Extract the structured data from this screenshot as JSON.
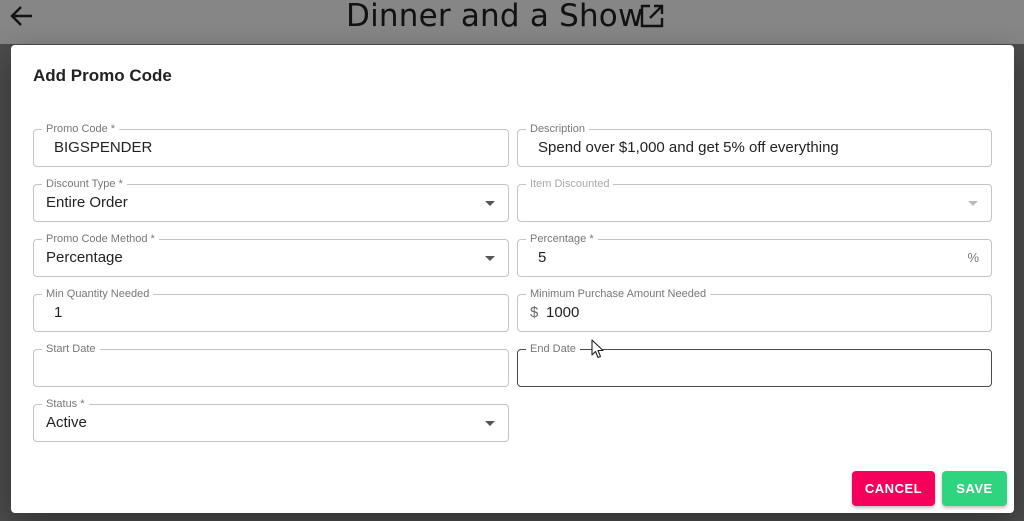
{
  "page": {
    "title": "Dinner and a Show",
    "back_icon": "arrow-left-icon",
    "edit_icon": "open-in-new-icon"
  },
  "dialog": {
    "title": "Add Promo Code",
    "fields": {
      "promo_code": {
        "label": "Promo Code *",
        "value": "BIGSPENDER"
      },
      "description": {
        "label": "Description",
        "value": "Spend over $1,000 and get 5% off everything"
      },
      "discount_type": {
        "label": "Discount Type *",
        "value": "Entire Order"
      },
      "item_discounted": {
        "label": "Item Discounted",
        "value": ""
      },
      "promo_code_method": {
        "label": "Promo Code Method *",
        "value": "Percentage"
      },
      "percentage": {
        "label": "Percentage *",
        "value": "5",
        "suffix": "%"
      },
      "min_quantity": {
        "label": "Min Quantity Needed",
        "value": "1"
      },
      "min_purchase": {
        "label": "Minimum Purchase Amount Needed",
        "prefix": "$",
        "value": "1000"
      },
      "start_date": {
        "label": "Start Date",
        "value": ""
      },
      "end_date": {
        "label": "End Date",
        "value": ""
      },
      "status": {
        "label": "Status *",
        "value": "Active"
      }
    },
    "buttons": {
      "cancel": "CANCEL",
      "save": "SAVE"
    }
  },
  "colors": {
    "cancel": "#f5005a",
    "save": "#2fd47f"
  }
}
